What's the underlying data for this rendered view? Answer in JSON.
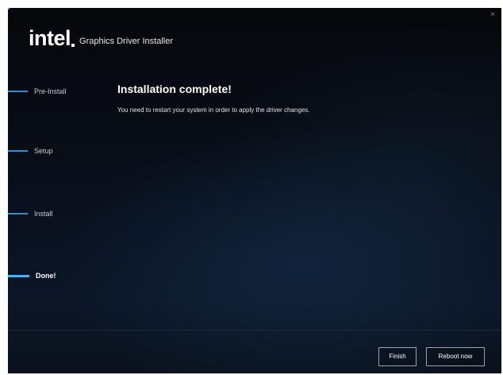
{
  "window": {
    "close_glyph": "×"
  },
  "header": {
    "logo_text": "intel",
    "title": "Graphics Driver Installer"
  },
  "steps": [
    {
      "label": "Pre-Install",
      "active": false
    },
    {
      "label": "Setup",
      "active": false
    },
    {
      "label": "Install",
      "active": false
    },
    {
      "label": "Done!",
      "active": true
    }
  ],
  "content": {
    "title": "Installation complete!",
    "message": "You need to restart your system in order to apply the driver changes."
  },
  "footer": {
    "finish_label": "Finish",
    "reboot_label": "Reboot now"
  },
  "colors": {
    "accent": "#2e8fd3",
    "accent_active": "#4ab3f4",
    "background": "#070b12"
  },
  "icons": {
    "close": "close-icon"
  }
}
